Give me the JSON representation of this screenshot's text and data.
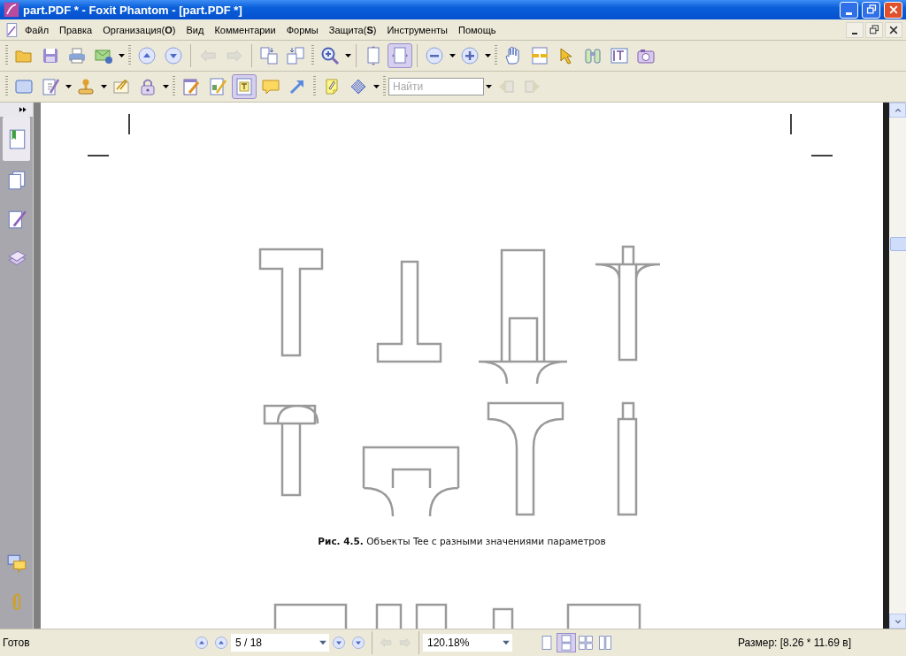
{
  "window": {
    "title": "part.PDF * - Foxit Phantom - [part.PDF *]"
  },
  "menu": [
    {
      "label": "Файл"
    },
    {
      "label": "Правка"
    },
    {
      "label": "Организация(**O**)"
    },
    {
      "label": "Вид"
    },
    {
      "label": "Комментарии"
    },
    {
      "label": "Формы"
    },
    {
      "label": "Защита(**S**)"
    },
    {
      "label": "Инструменты"
    },
    {
      "label": "Помощь"
    }
  ],
  "toolbars": [
    {
      "buttons": [
        {
          "pressed": false,
          "disabled": false
        },
        {
          "pressed": false,
          "disabled": false
        },
        {
          "pressed": false,
          "disabled": false
        },
        {
          "pressed": false,
          "disabled": false
        },
        {
          "pressed": false,
          "disabled": false
        },
        {
          "pressed": false,
          "disabled": false
        },
        {
          "pressed": false,
          "disabled": true
        },
        {
          "pressed": false,
          "disabled": true
        },
        {
          "pressed": false,
          "disabled": false
        },
        {
          "pressed": false,
          "disabled": false
        },
        {
          "pressed": false,
          "disabled": false
        },
        {
          "pressed": false,
          "disabled": false
        },
        {
          "pressed": true,
          "disabled": false
        },
        {
          "pressed": false,
          "disabled": false
        },
        {
          "pressed": false,
          "disabled": false
        },
        {
          "pressed": false,
          "disabled": false
        },
        {
          "pressed": false,
          "disabled": false
        },
        {
          "pressed": false,
          "disabled": false
        },
        {
          "pressed": false,
          "disabled": false
        },
        {
          "pressed": false,
          "disabled": false
        },
        {
          "pressed": false,
          "disabled": false
        }
      ]
    },
    {
      "buttons": [
        {
          "pressed": false,
          "disabled": false
        },
        {
          "pressed": false,
          "disabled": false
        },
        {
          "pressed": false,
          "disabled": false
        },
        {
          "pressed": false,
          "disabled": false
        },
        {
          "pressed": false,
          "disabled": false
        },
        {
          "pressed": false,
          "disabled": false
        },
        {
          "pressed": false,
          "disabled": false
        },
        {
          "pressed": true,
          "disabled": false
        },
        {
          "pressed": false,
          "disabled": false
        },
        {
          "pressed": false,
          "disabled": false
        }
      ],
      "fill_tools": [
        {
          "disabled": false
        },
        {
          "disabled": false
        }
      ],
      "search": {
        "placeholder": "Найти"
      },
      "find_buttons": [
        {
          "disabled": true
        },
        {
          "disabled": true
        }
      ]
    }
  ],
  "sidebar": {
    "items": [
      {
        "selected": true
      },
      {
        "selected": false
      },
      {
        "selected": false
      },
      {
        "selected": false
      },
      {
        "selected": false
      },
      {
        "selected": false
      }
    ]
  },
  "document": {
    "caption": "**Рис. 4.5.** Объекты Tee с разными значениями параметров"
  },
  "status_bar": {
    "status": "Готов",
    "page": "5 / 18",
    "zoom": "120.18%",
    "view_modes": [
      {
        "selected": false
      },
      {
        "selected": true
      },
      {
        "selected": false
      },
      {
        "selected": false
      }
    ],
    "size": "Размер: [8.26 * 11.69 в]"
  }
}
